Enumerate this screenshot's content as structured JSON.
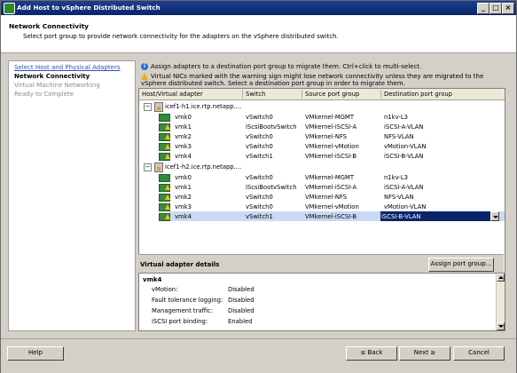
{
  "window": {
    "title": "Add Host to vSphere Distributed Switch",
    "minimize": "_",
    "maximize": "□",
    "close": "×"
  },
  "header": {
    "title": "Network Connectivity",
    "subtitle": "Select port group to provide network connectivity for the adapters on the vSphere distributed switch."
  },
  "steps": [
    {
      "label": "Select Host and Physical Adapters",
      "state": "done"
    },
    {
      "label": "Network Connectivity",
      "state": "current"
    },
    {
      "label": "Virtual Machine Networking",
      "state": "disabled"
    },
    {
      "label": "Ready to Complete",
      "state": "disabled"
    }
  ],
  "info": {
    "line1": "Assign adapters to a destination port group to migrate them. Ctrl+click to multi-select.",
    "line2": "Virtual NICs marked with the warning sign might lose network connectivity unless they are migrated to the vSphere distributed switch. Select a destination port group in order to migrate them."
  },
  "grid": {
    "columns": [
      "Host/Virtual adapter",
      "Switch",
      "Source port group",
      "Destination port group"
    ],
    "hosts": [
      {
        "name": "icef1-h1.ice.rtp.netapp....",
        "adapters": [
          {
            "name": "vmk0",
            "switch": "vSwitch0",
            "source": "VMkernel-MGMT",
            "dest": "n1kv-L3",
            "warn": false
          },
          {
            "name": "vmk1",
            "switch": "iScsiBootvSwitch",
            "source": "VMkernel-iSCSI-A",
            "dest": "iSCSI-A-VLAN",
            "warn": true
          },
          {
            "name": "vmk2",
            "switch": "vSwitch0",
            "source": "VMkernel-NFS",
            "dest": "NFS-VLAN",
            "warn": true
          },
          {
            "name": "vmk3",
            "switch": "vSwitch0",
            "source": "VMkernel-vMotion",
            "dest": "vMotion-VLAN",
            "warn": true
          },
          {
            "name": "vmk4",
            "switch": "vSwitch1",
            "source": "VMkernel-iSCSI-B",
            "dest": "iSCSI-B-VLAN",
            "warn": true
          }
        ]
      },
      {
        "name": "icef1-h2.ice.rtp.netapp....",
        "adapters": [
          {
            "name": "vmk0",
            "switch": "vSwitch0",
            "source": "VMkernel-MGMT",
            "dest": "n1kv-L3",
            "warn": false
          },
          {
            "name": "vmk1",
            "switch": "iScsiBootvSwitch",
            "source": "VMkernel-iSCSI-A",
            "dest": "iSCSI-A-VLAN",
            "warn": true
          },
          {
            "name": "vmk2",
            "switch": "vSwitch0",
            "source": "VMkernel-NFS",
            "dest": "NFS-VLAN",
            "warn": true
          },
          {
            "name": "vmk3",
            "switch": "vSwitch0",
            "source": "VMkernel-vMotion",
            "dest": "vMotion-VLAN",
            "warn": true
          },
          {
            "name": "vmk4",
            "switch": "vSwitch1",
            "source": "VMkernel-iSCSI-B",
            "dest": "iSCSI-B-VLAN",
            "warn": true,
            "selected": true
          }
        ]
      }
    ]
  },
  "details": {
    "title": "Virtual adapter details",
    "assign_button": "Assign port group...",
    "adapter": "vmk4",
    "props": [
      {
        "key": "vMotion:",
        "value": "Disabled"
      },
      {
        "key": "Fault tolerance logging:",
        "value": "Disabled"
      },
      {
        "key": "Management traffic:",
        "value": "Disabled"
      },
      {
        "key": "iSCSI port binding:",
        "value": "Enabled"
      }
    ]
  },
  "footer": {
    "help": "Help",
    "back": "≤ Back",
    "next": "Next ≥",
    "cancel": "Cancel"
  },
  "colors": {
    "title_bar": "#0a246a",
    "selection": "#0a246a",
    "link": "#2c4ec4",
    "nic_green": "#2e8b3e",
    "warning": "#e0b020"
  }
}
